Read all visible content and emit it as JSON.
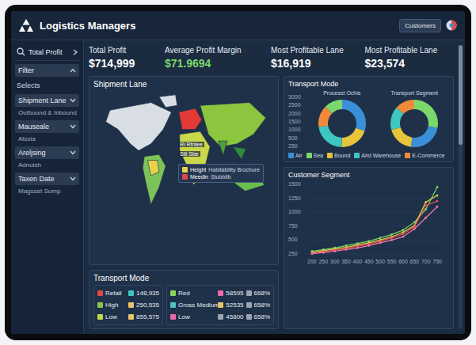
{
  "header": {
    "title": "Logistics Managers",
    "button": "Customers"
  },
  "sidebar": {
    "search": "Total Profit",
    "filter": "Filter",
    "section": "Selects",
    "groups": [
      {
        "label": "Shipment Lane",
        "value": "Outbound & Inbound"
      },
      {
        "label": "Mauseale",
        "value": "Atssia"
      },
      {
        "label": "Areljsing",
        "value": "Adnuish"
      },
      {
        "label": "Taxen Date",
        "value": "Magsset Sump"
      }
    ]
  },
  "kpis": [
    {
      "label": "Total Profit",
      "value": "$714,999",
      "color": "#ffffff"
    },
    {
      "label": "Average Profit Margin",
      "value": "$71.9694",
      "color": "#7bd86a"
    },
    {
      "label": "Most Profitable Lane",
      "value": "$16,919",
      "color": "#ffffff"
    },
    {
      "label": "Most Profitable Lane",
      "value": "$23,574",
      "color": "#ffffff"
    }
  ],
  "map_panel": {
    "title": "Shipment Lane",
    "regions": [
      {
        "color": "#d9dee4"
      },
      {
        "color": "#d9dee4"
      },
      {
        "color": "#7cc45a"
      },
      {
        "color": "#e8d24a"
      },
      {
        "color": "#c9d84a"
      },
      {
        "color": "#8cc63f"
      },
      {
        "color": "#4f9e3a"
      },
      {
        "color": "#2e8b3a"
      },
      {
        "color": "#6bbf4f"
      },
      {
        "color": "#e53935"
      }
    ],
    "labels": [
      "Ri Rtriiee",
      "Sili Sbe"
    ],
    "tooltip": [
      {
        "label": "Height",
        "value": "Habitability Brochure",
        "color": "#e8d24a"
      },
      {
        "label": "Meedin",
        "value": "Stubbitb",
        "color": "#e04848"
      }
    ]
  },
  "mode_chart": {
    "title": "Transport Mode",
    "y_ticks": [
      "3000",
      "2500",
      "2000",
      "1500",
      "1000",
      "500",
      "250"
    ],
    "donuts": [
      {
        "subtitle": "Processt Ochis",
        "segments": [
          {
            "value": 30,
            "color": "#3a8fd8"
          },
          {
            "value": 20,
            "color": "#e8c43a"
          },
          {
            "value": 22,
            "color": "#3ec7c0"
          },
          {
            "value": 15,
            "color": "#f08a3a"
          },
          {
            "value": 13,
            "color": "#7bd86a"
          }
        ]
      },
      {
        "subtitle": "Transport Segment",
        "segments": [
          {
            "value": 28,
            "color": "#7bd86a"
          },
          {
            "value": 24,
            "color": "#3a8fd8"
          },
          {
            "value": 18,
            "color": "#e8c43a"
          },
          {
            "value": 16,
            "color": "#3ec7c0"
          },
          {
            "value": 14,
            "color": "#f08a3a"
          }
        ]
      }
    ],
    "legend": [
      {
        "label": "Air",
        "color": "#3a8fd8"
      },
      {
        "label": "Sea",
        "color": "#7bd86a"
      },
      {
        "label": "Bound",
        "color": "#e8c43a"
      },
      {
        "label": "Aird Warehouse",
        "color": "#3ec7c0"
      },
      {
        "label": "E-Commerce",
        "color": "#f08a3a"
      }
    ]
  },
  "segment_chart": {
    "title": "Customer Segment",
    "y_ticks": [
      "1500",
      "1250",
      "1000",
      "750",
      "500",
      "250"
    ],
    "x_ticks": [
      "200",
      "250",
      "300",
      "350",
      "400",
      "450",
      "500",
      "550",
      "600",
      "650",
      "700",
      "750"
    ],
    "series": [
      {
        "color": "#7bd86a",
        "values": [
          300,
          330,
          360,
          400,
          440,
          480,
          540,
          600,
          680,
          820,
          1050,
          1450
        ]
      },
      {
        "color": "#e8d24a",
        "values": [
          280,
          310,
          340,
          370,
          410,
          450,
          500,
          560,
          640,
          760,
          1180,
          1300
        ]
      },
      {
        "color": "#e94f4f",
        "values": [
          265,
          290,
          320,
          350,
          390,
          430,
          480,
          540,
          610,
          740,
          1120,
          1200
        ]
      },
      {
        "color": "#f07aa8",
        "values": [
          255,
          275,
          300,
          330,
          360,
          400,
          450,
          500,
          560,
          700,
          900,
          1100
        ]
      }
    ]
  },
  "mode_table": {
    "title": "Transport Mode",
    "left": [
      {
        "label": "Retail",
        "color": "#e04848",
        "value": "148,935",
        "value_color": "#3ec7c0"
      },
      {
        "label": "High",
        "color": "#8bc34a",
        "value": "250,535",
        "value_color": "#e9c46a"
      },
      {
        "label": "Low",
        "color": "#c6d84a",
        "value": "855,575",
        "value_color": "#e9c46a"
      }
    ],
    "right": [
      {
        "label": "Red",
        "color": "#8bd35a",
        "value": "58595",
        "value_color": "#e86aa8",
        "pct": "668%",
        "pct_color": "#9aa5b1"
      },
      {
        "label": "Gross Medium",
        "color": "#4fc3c0",
        "value": "52535",
        "value_color": "#e9c46a",
        "pct": "658%",
        "pct_color": "#9aa5b1"
      },
      {
        "label": "Low",
        "color": "#e86aa8",
        "value": "45800",
        "value_color": "#9aa5b1",
        "pct": "658%",
        "pct_color": "#9aa5b1"
      }
    ]
  },
  "scrollbar": {
    "level": 0.35
  }
}
